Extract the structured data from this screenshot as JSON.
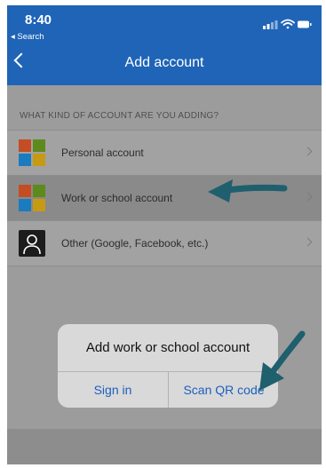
{
  "status_bar": {
    "time": "8:40",
    "back_app": "◂ Search",
    "icons": [
      "signal-icon",
      "wifi-icon",
      "battery-icon"
    ]
  },
  "nav": {
    "back_icon": "chevron-left-icon",
    "title": "Add account"
  },
  "section_heading": "WHAT KIND OF ACCOUNT ARE YOU ADDING?",
  "accounts": [
    {
      "label": "Personal account",
      "icon": "microsoft-logo-icon",
      "selected": false
    },
    {
      "label": "Work or school account",
      "icon": "microsoft-logo-icon",
      "selected": true
    },
    {
      "label": "Other (Google, Facebook, etc.)",
      "icon": "person-icon",
      "selected": false
    }
  ],
  "dialog": {
    "title": "Add work or school account",
    "sign_in": "Sign in",
    "scan_qr": "Scan QR code"
  },
  "colors": {
    "header": "#1f64b7",
    "link": "#1c5fbf",
    "annotation_arrow": "#1f5f6e"
  }
}
